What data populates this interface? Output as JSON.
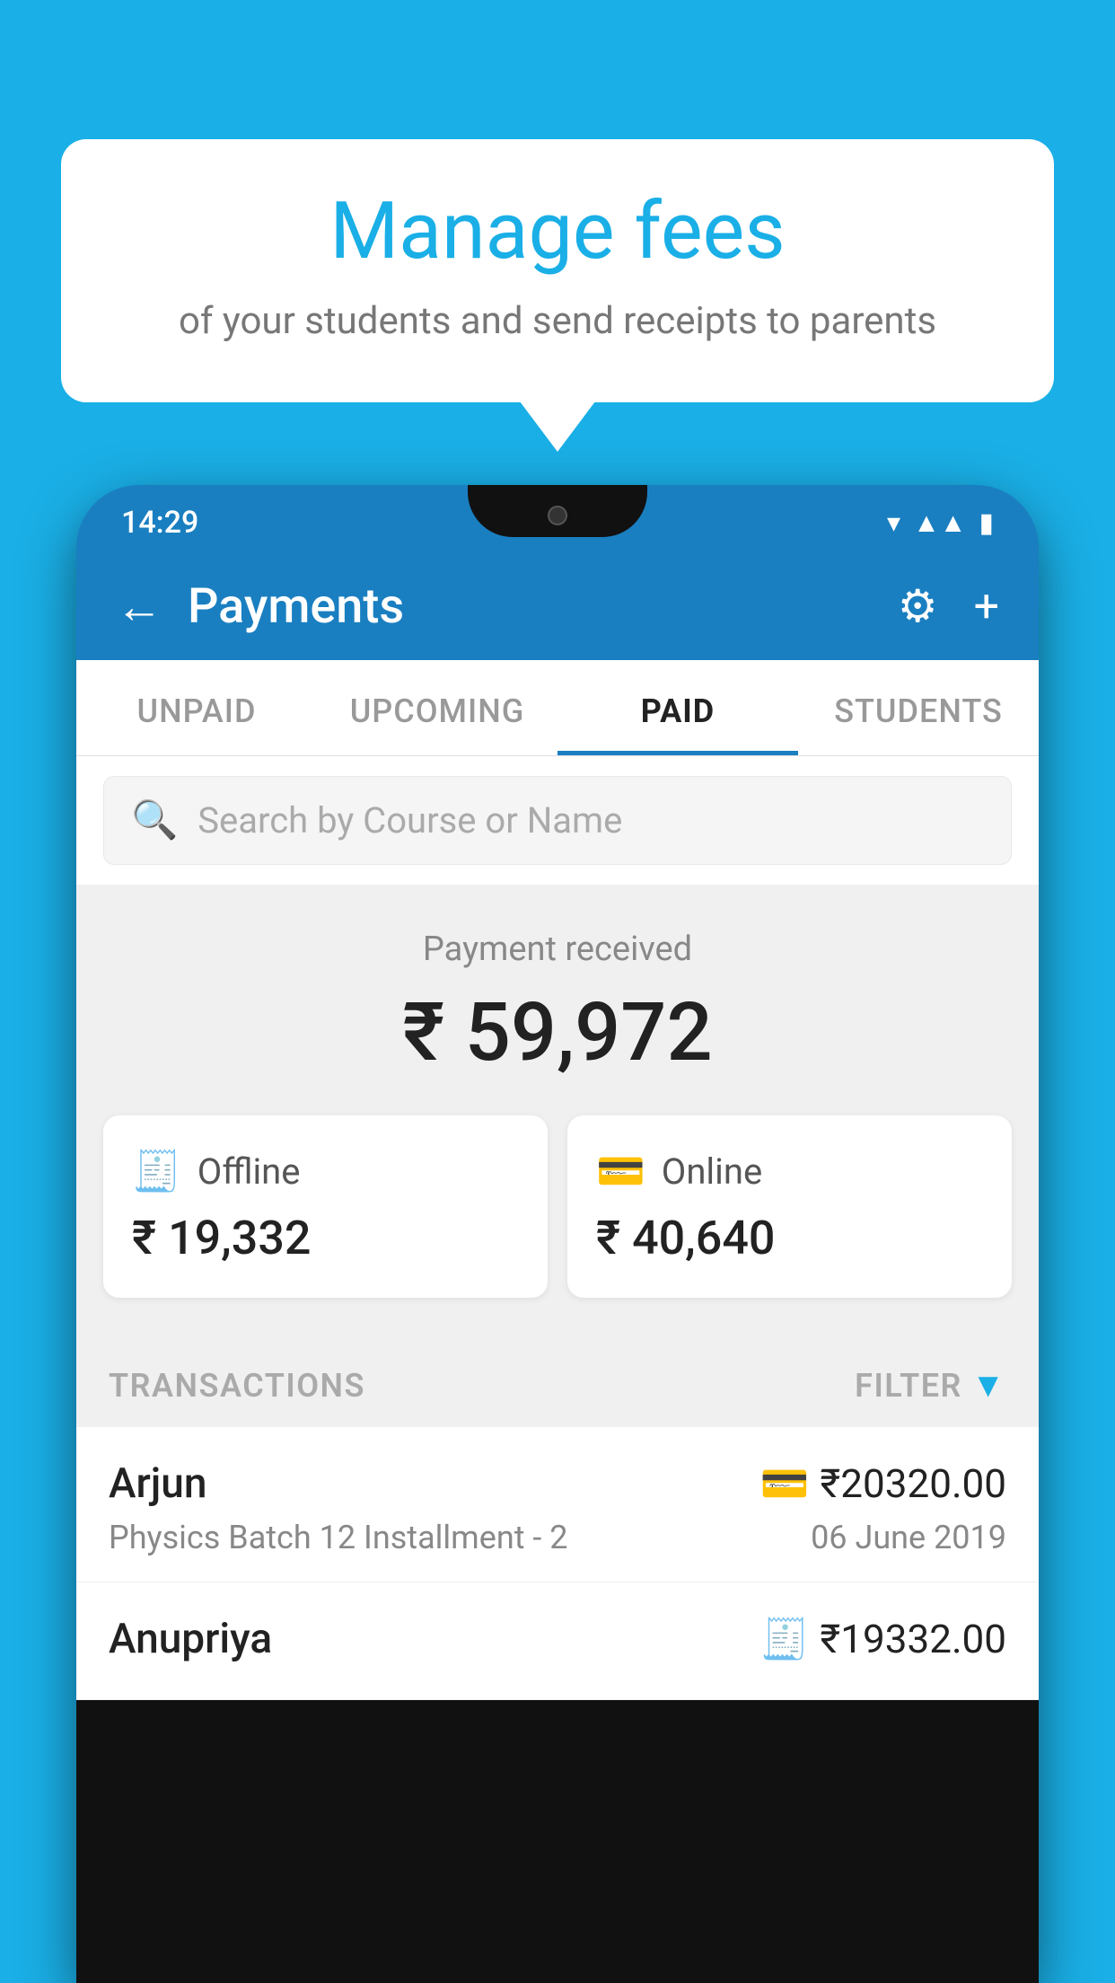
{
  "background_color": "#1AAFE6",
  "bubble": {
    "title": "Manage fees",
    "subtitle": "of your students and send receipts to parents"
  },
  "status_bar": {
    "time": "14:29",
    "icons": [
      "wifi",
      "signal",
      "battery"
    ]
  },
  "header": {
    "title": "Payments",
    "back_label": "←",
    "settings_label": "⚙",
    "add_label": "+"
  },
  "tabs": [
    {
      "label": "UNPAID",
      "active": false
    },
    {
      "label": "UPCOMING",
      "active": false
    },
    {
      "label": "PAID",
      "active": true
    },
    {
      "label": "STUDENTS",
      "active": false
    }
  ],
  "search": {
    "placeholder": "Search by Course or Name"
  },
  "payment_summary": {
    "label": "Payment received",
    "amount": "₹ 59,972"
  },
  "payment_cards": [
    {
      "icon": "💳",
      "label": "Offline",
      "amount": "₹ 19,332"
    },
    {
      "icon": "💳",
      "label": "Online",
      "amount": "₹ 40,640"
    }
  ],
  "transactions_header": {
    "label": "TRANSACTIONS",
    "filter_label": "FILTER"
  },
  "transactions": [
    {
      "name": "Arjun",
      "course": "Physics Batch 12 Installment - 2",
      "amount": "₹20320.00",
      "date": "06 June 2019",
      "mode": "online"
    },
    {
      "name": "Anupriya",
      "course": "",
      "amount": "₹19332.00",
      "date": "",
      "mode": "offline"
    }
  ]
}
